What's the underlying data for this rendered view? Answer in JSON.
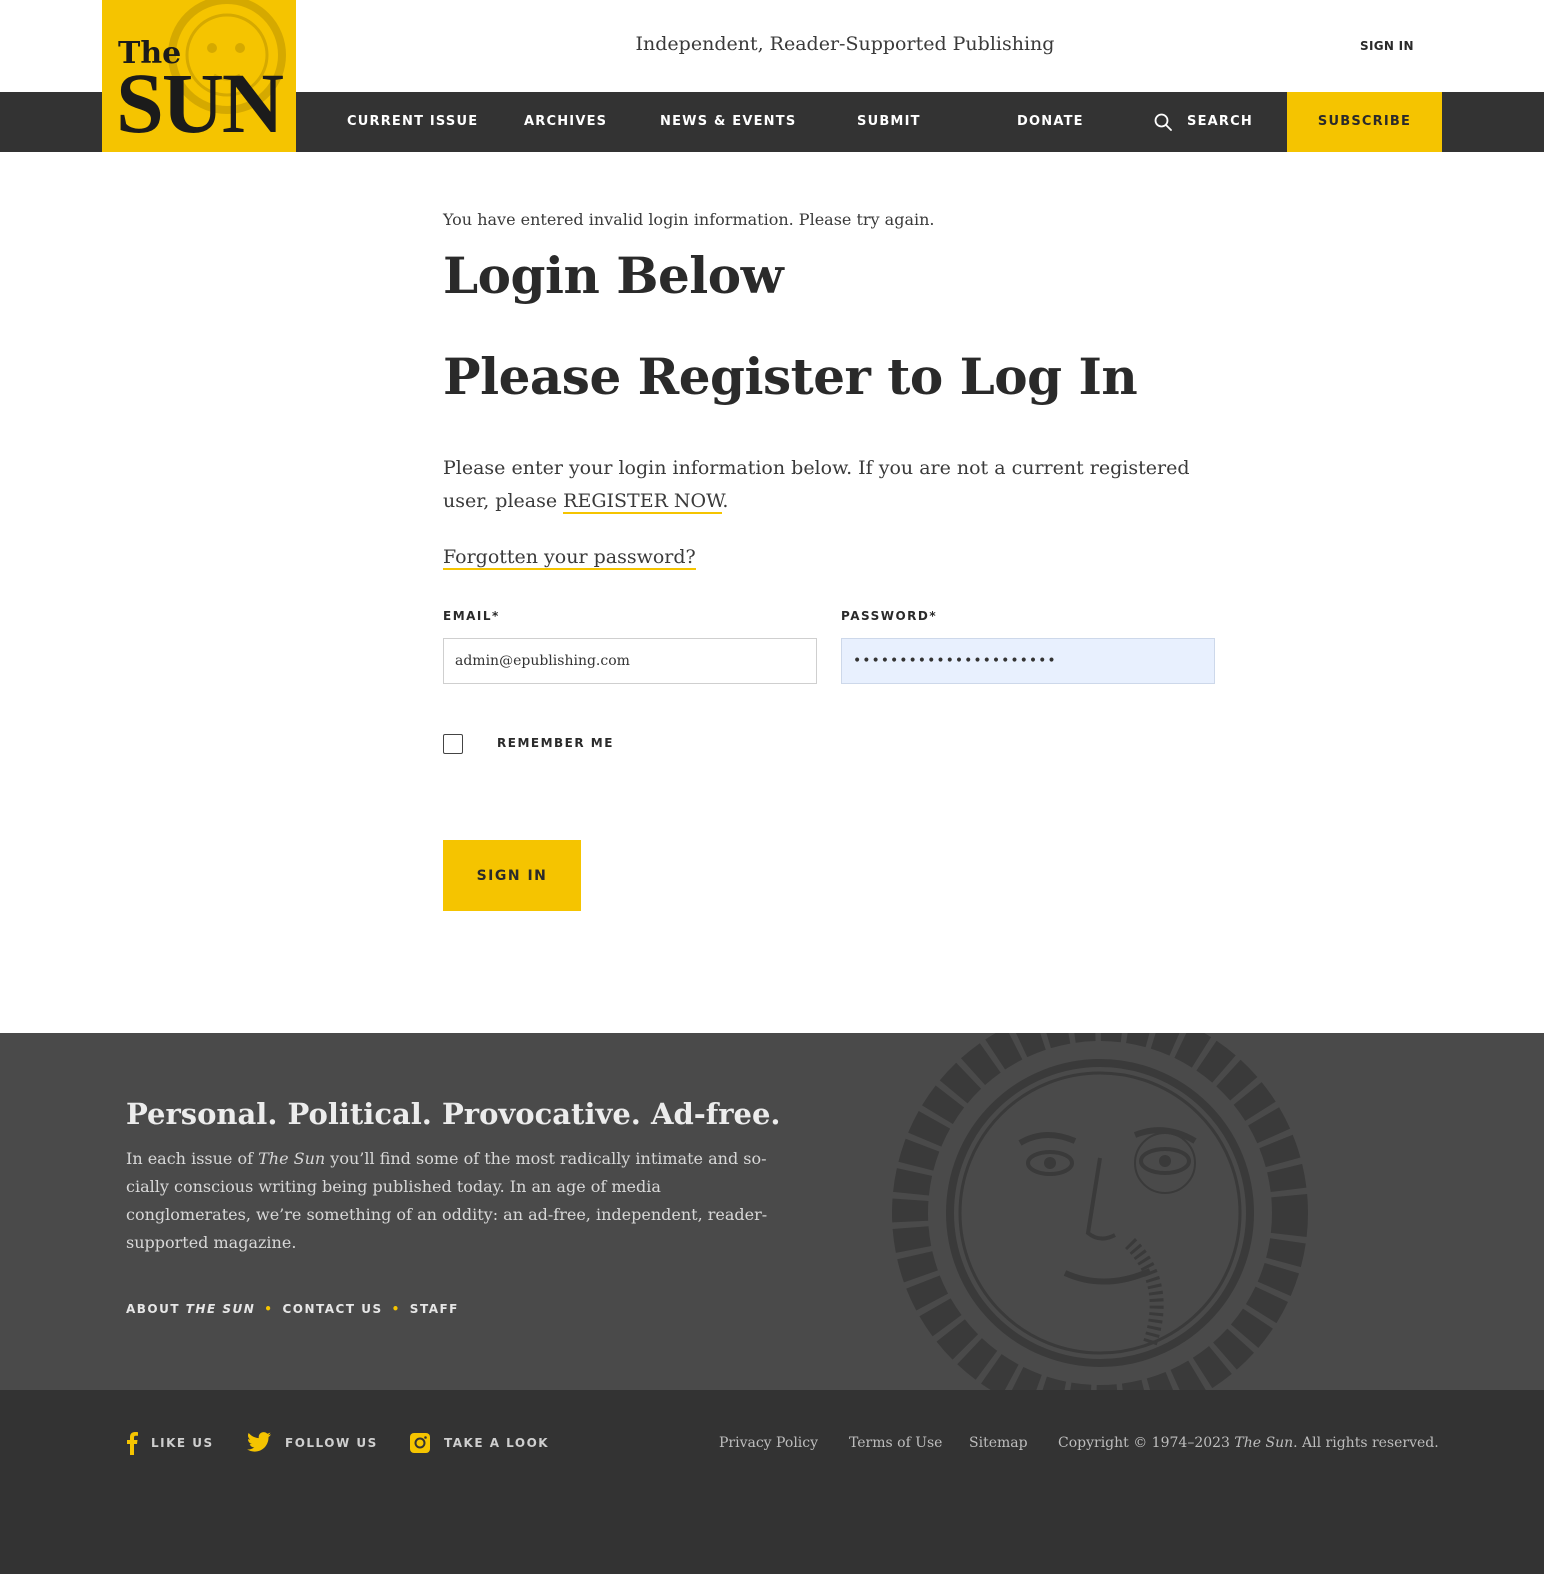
{
  "header": {
    "tagline": "Independent, Reader-Supported Publishing",
    "sign_in": "SIGN IN",
    "logo": {
      "the": "The",
      "sun": "SUN"
    }
  },
  "nav": {
    "items": [
      "CURRENT ISSUE",
      "ARCHIVES",
      "NEWS & EVENTS",
      "SUBMIT",
      "DONATE"
    ],
    "search": "SEARCH",
    "subscribe": "SUBSCRIBE"
  },
  "main": {
    "error": "You have entered invalid login information. Please try again.",
    "heading_login": "Login Below",
    "heading_register": "Please Register to Log In",
    "intro_text": "Please enter your login information below. If you are not a current registered user, please ",
    "register_link": "REGISTER NOW",
    "intro_end": ".",
    "forgot": "Forgotten your password?",
    "email_label": "EMAIL*",
    "email_value": "admin@epublishing.com",
    "password_label": "PASSWORD*",
    "password_value": "••••••••••••••••••••••",
    "remember": "REMEMBER ME",
    "signin_button": "SIGN IN"
  },
  "footer": {
    "slogan": "Personal. Political. Provocative. Ad-free.",
    "body_pre": "In each issue of ",
    "body_em": "The Sun",
    "body_post": " you’ll find some of the most radically intimate and so­cially conscious writing being published today. In an age of media conglomerates, we’re something of an oddity: an ad-free, independent, reader-supported magazine.",
    "link_about_pre": "ABOUT ",
    "link_about_em": "THE SUN",
    "link_contact": "CONTACT US",
    "link_staff": "STAFF",
    "social": {
      "facebook": "LIKE US",
      "twitter": "FOLLOW US",
      "instagram": "TAKE A LOOK"
    },
    "legal": {
      "privacy": "Privacy Policy",
      "terms": "Terms of Use",
      "sitemap": "Sitemap"
    },
    "copyright_pre": "Copyright © 1974–2023 ",
    "copyright_em": "The Sun",
    "copyright_post": ". All rights reserved."
  },
  "colors": {
    "accent": "#f5c400",
    "nav_bg": "#333333",
    "footer_bg": "#4a4a4a",
    "footer_bottom_bg": "#333333"
  }
}
